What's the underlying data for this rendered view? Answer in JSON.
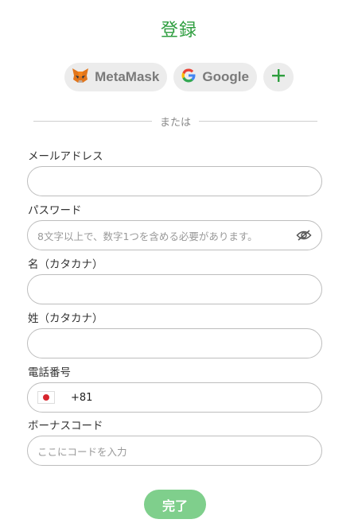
{
  "header": {
    "title": "登録"
  },
  "social": {
    "metamask_label": "MetaMask",
    "google_label": "Google",
    "more_label": "+"
  },
  "divider_text": "または",
  "form": {
    "email": {
      "label": "メールアドレス",
      "placeholder": ""
    },
    "password": {
      "label": "パスワード",
      "placeholder": "8文字以上で、数字1つを含める必要があります。"
    },
    "first_name": {
      "label": "名（カタカナ）",
      "placeholder": ""
    },
    "last_name": {
      "label": "姓（カタカナ）",
      "placeholder": ""
    },
    "phone": {
      "label": "電話番号",
      "country_code": "+81"
    },
    "bonus_code": {
      "label": "ボーナスコード",
      "placeholder": "ここにコードを入力"
    }
  },
  "submit_label": "完了",
  "colors": {
    "accent": "#2e9e3f",
    "submit_bg": "#7fcf8c",
    "chip_bg": "#ececec"
  }
}
